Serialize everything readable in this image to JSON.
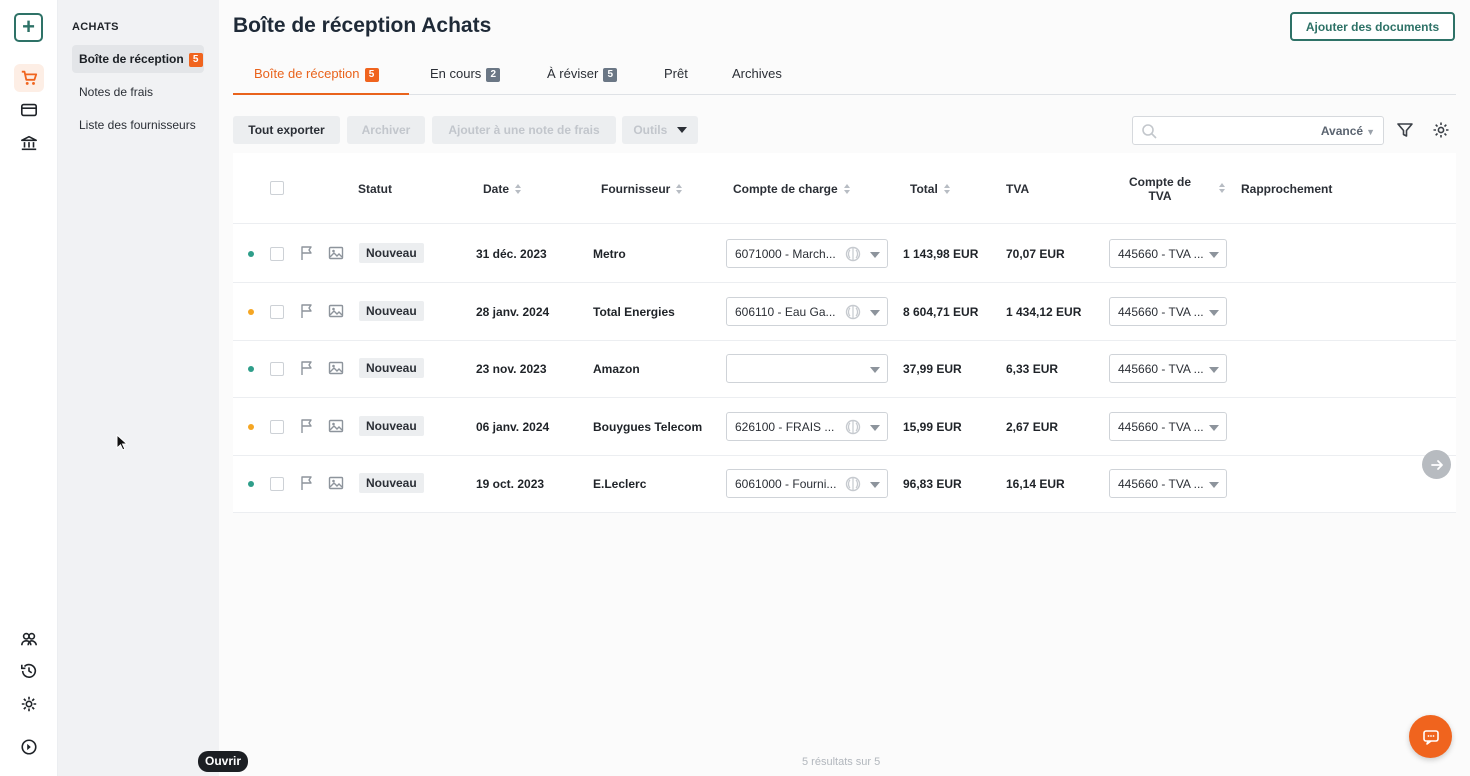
{
  "rail": {
    "new_label": "+",
    "icons": [
      "cart-icon",
      "card-icon",
      "bank-icon",
      "team-icon",
      "history-icon",
      "settings-icon",
      "play-icon"
    ]
  },
  "subnav": {
    "heading": "ACHATS",
    "items": [
      {
        "label": "Boîte de réception",
        "badge": "5"
      },
      {
        "label": "Notes de frais"
      },
      {
        "label": "Liste des fournisseurs"
      }
    ]
  },
  "page": {
    "title": "Boîte de réception Achats",
    "add_documents_label": "Ajouter des documents"
  },
  "tabs": [
    {
      "label": "Boîte de réception",
      "badge": "5"
    },
    {
      "label": "En cours",
      "badge": "2"
    },
    {
      "label": "À réviser",
      "badge": "5"
    },
    {
      "label": "Prêt"
    },
    {
      "label": "Archives"
    }
  ],
  "toolbar": {
    "export_label": "Tout exporter",
    "archive_label": "Archiver",
    "add_to_note_label": "Ajouter à une note de frais",
    "tools_label": "Outils",
    "search_placeholder": "",
    "advanced_label": "Avancé"
  },
  "table": {
    "headers": {
      "statut": "Statut",
      "date": "Date",
      "fournisseur": "Fournisseur",
      "compte_charge": "Compte de charge",
      "total": "Total",
      "tva": "TVA",
      "compte_tva_1": "Compte de",
      "compte_tva_2": "TVA",
      "rapprochement": "Rapprochement"
    },
    "rows": [
      {
        "dot_color": "#2e9e8a",
        "status": "Nouveau",
        "date": "31 déc. 2023",
        "supplier": "Metro",
        "charge_account": "6071000 - March...",
        "total": "1 143,98 EUR",
        "tva": "70,07 EUR",
        "tva_account": "445660 - TVA ..."
      },
      {
        "dot_color": "#f5a623",
        "status": "Nouveau",
        "date": "28 janv. 2024",
        "supplier": "Total Energies",
        "charge_account": "606110 - Eau Ga...",
        "total": "8 604,71 EUR",
        "tva": "1 434,12 EUR",
        "tva_account": "445660 - TVA ..."
      },
      {
        "dot_color": "#2e9e8a",
        "status": "Nouveau",
        "date": "23 nov. 2023",
        "supplier": "Amazon",
        "charge_account": "",
        "total": "37,99 EUR",
        "tva": "6,33 EUR",
        "tva_account": "445660 - TVA ..."
      },
      {
        "dot_color": "#f5a623",
        "status": "Nouveau",
        "date": "06 janv. 2024",
        "supplier": "Bouygues Telecom",
        "charge_account": "626100 - FRAIS ...",
        "total": "15,99 EUR",
        "tva": "2,67 EUR",
        "tva_account": "445660 - TVA ..."
      },
      {
        "dot_color": "#2e9e8a",
        "status": "Nouveau",
        "date": "19 oct. 2023",
        "supplier": "E.Leclerc",
        "charge_account": "6061000 - Fourni...",
        "total": "96,83 EUR",
        "tva": "16,14 EUR",
        "tva_account": "445660 - TVA ..."
      }
    ]
  },
  "footer": {
    "results": "5 résultats sur 5",
    "tooltip": "Ouvrir"
  },
  "colors": {
    "brand_green": "#2e7267",
    "accent_orange": "#f0641e"
  }
}
